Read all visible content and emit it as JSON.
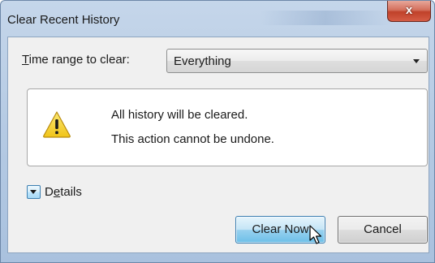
{
  "window": {
    "title": "Clear Recent History",
    "close_glyph": "x"
  },
  "time_range": {
    "label_underlined_char": "T",
    "label_rest": "ime range to clear:",
    "selected_value": "Everything"
  },
  "message": {
    "icon": "warning-icon",
    "line1": "All history will be cleared.",
    "line2": "This action cannot be undone."
  },
  "details": {
    "label_start": "D",
    "label_underlined_char": "e",
    "label_end": "tails",
    "expanded": false
  },
  "buttons": {
    "clear_now": "Clear Now",
    "cancel": "Cancel"
  },
  "colors": {
    "titlebar": "#b6cbe4",
    "close_button": "#c0412a",
    "primary_button": "#98d1ef",
    "warning_fill": "#f5d328"
  }
}
